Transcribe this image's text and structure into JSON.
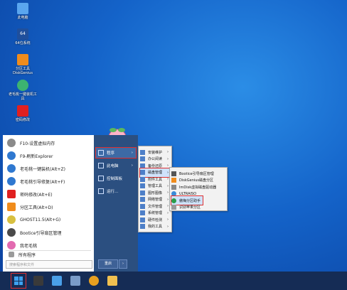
{
  "desktop": {
    "icons": [
      {
        "label": "此电脑",
        "name": "this-pc-icon",
        "color": "#5aa6ef"
      },
      {
        "label": "64位系统",
        "name": "os64-icon",
        "color": "#1f4f9c"
      },
      {
        "label": "分区工具DiskGenius",
        "name": "partition-tool-icon",
        "color": "#f08c1c"
      },
      {
        "label": "老毛桃一键装机工具",
        "name": "one-click-install-icon",
        "color": "#3cb371"
      },
      {
        "label": "密码修改",
        "name": "password-tool-icon",
        "color": "#e02020"
      }
    ]
  },
  "start_menu": {
    "items": [
      {
        "label": "F10-设置虚拟内存",
        "name": "sm-item-virtual-memory",
        "color": "#8a8a8a"
      },
      {
        "label": "F9-刷新Explorer",
        "name": "sm-item-refresh-explorer",
        "color": "#2f78d0"
      },
      {
        "label": "老毛桃一键装机(Alt+Z)",
        "name": "sm-item-one-click-install",
        "color": "#2f78d0"
      },
      {
        "label": "老毛桃引导修复(Alt+F)",
        "name": "sm-item-boot-repair",
        "color": "#2f78d0"
      },
      {
        "label": "密码修改(Alt+E)",
        "name": "sm-item-password",
        "color": "#e02020"
      },
      {
        "label": "分区工具(Alt+D)",
        "name": "sm-item-partition",
        "color": "#f08c1c"
      },
      {
        "label": "GHOST11.5(Alt+G)",
        "name": "sm-item-ghost",
        "color": "#d8c040"
      },
      {
        "label": "Bootice引导扇区管理",
        "name": "sm-item-bootice",
        "color": "#4a4a4a"
      },
      {
        "label": "我老毛桃",
        "name": "sm-item-me",
        "color": "#e26ab0"
      }
    ],
    "all_programs": "所有程序",
    "search_placeholder": "搜索程序和文件",
    "right": [
      {
        "label": "程序",
        "name": "right-item-programs",
        "arrow": "›"
      },
      {
        "label": "此电脑",
        "name": "right-item-this-pc",
        "arrow": "›"
      },
      {
        "label": "控制面板",
        "name": "right-item-control-panel",
        "arrow": ""
      },
      {
        "label": "运行...",
        "name": "right-item-run",
        "arrow": ""
      }
    ],
    "restart": "重启",
    "restart_arrow": "›"
  },
  "programs_menu": {
    "items": [
      {
        "label": "安装维护",
        "arrow": "›"
      },
      {
        "label": "办公阅读",
        "arrow": "›"
      },
      {
        "label": "备份还原",
        "arrow": "›"
      },
      {
        "label": "磁盘管理",
        "arrow": "›"
      },
      {
        "label": "附件工具",
        "arrow": "›"
      },
      {
        "label": "管理工具",
        "arrow": "›"
      },
      {
        "label": "图形图像",
        "arrow": "›"
      },
      {
        "label": "网络管理",
        "arrow": "›"
      },
      {
        "label": "文件管理",
        "arrow": "›"
      },
      {
        "label": "系统管理",
        "arrow": "›"
      },
      {
        "label": "硬件检测",
        "arrow": "›"
      },
      {
        "label": "我的工具",
        "arrow": "›"
      }
    ]
  },
  "disk_menu": {
    "items": [
      {
        "label": "Bootice引导扇区管理"
      },
      {
        "label": "DiskGenius磁盘分区"
      },
      {
        "label": "ImDisk虚拟磁盘驱动器"
      },
      {
        "label": "ULTRAISO"
      },
      {
        "label": "傲梅分区助手"
      },
      {
        "label": "识别苹果分区"
      }
    ]
  },
  "taskbar": {
    "icons": [
      {
        "name": "start-button",
        "color": ""
      },
      {
        "name": "cmd-icon",
        "color": "#3a3a3a"
      },
      {
        "name": "computer-icon",
        "color": "#4aa0e8"
      },
      {
        "name": "network-icon",
        "color": "#7a9cc8"
      },
      {
        "name": "media-icon",
        "color": "#e8a020"
      },
      {
        "name": "folder-icon",
        "color": "#f0c050"
      }
    ]
  }
}
